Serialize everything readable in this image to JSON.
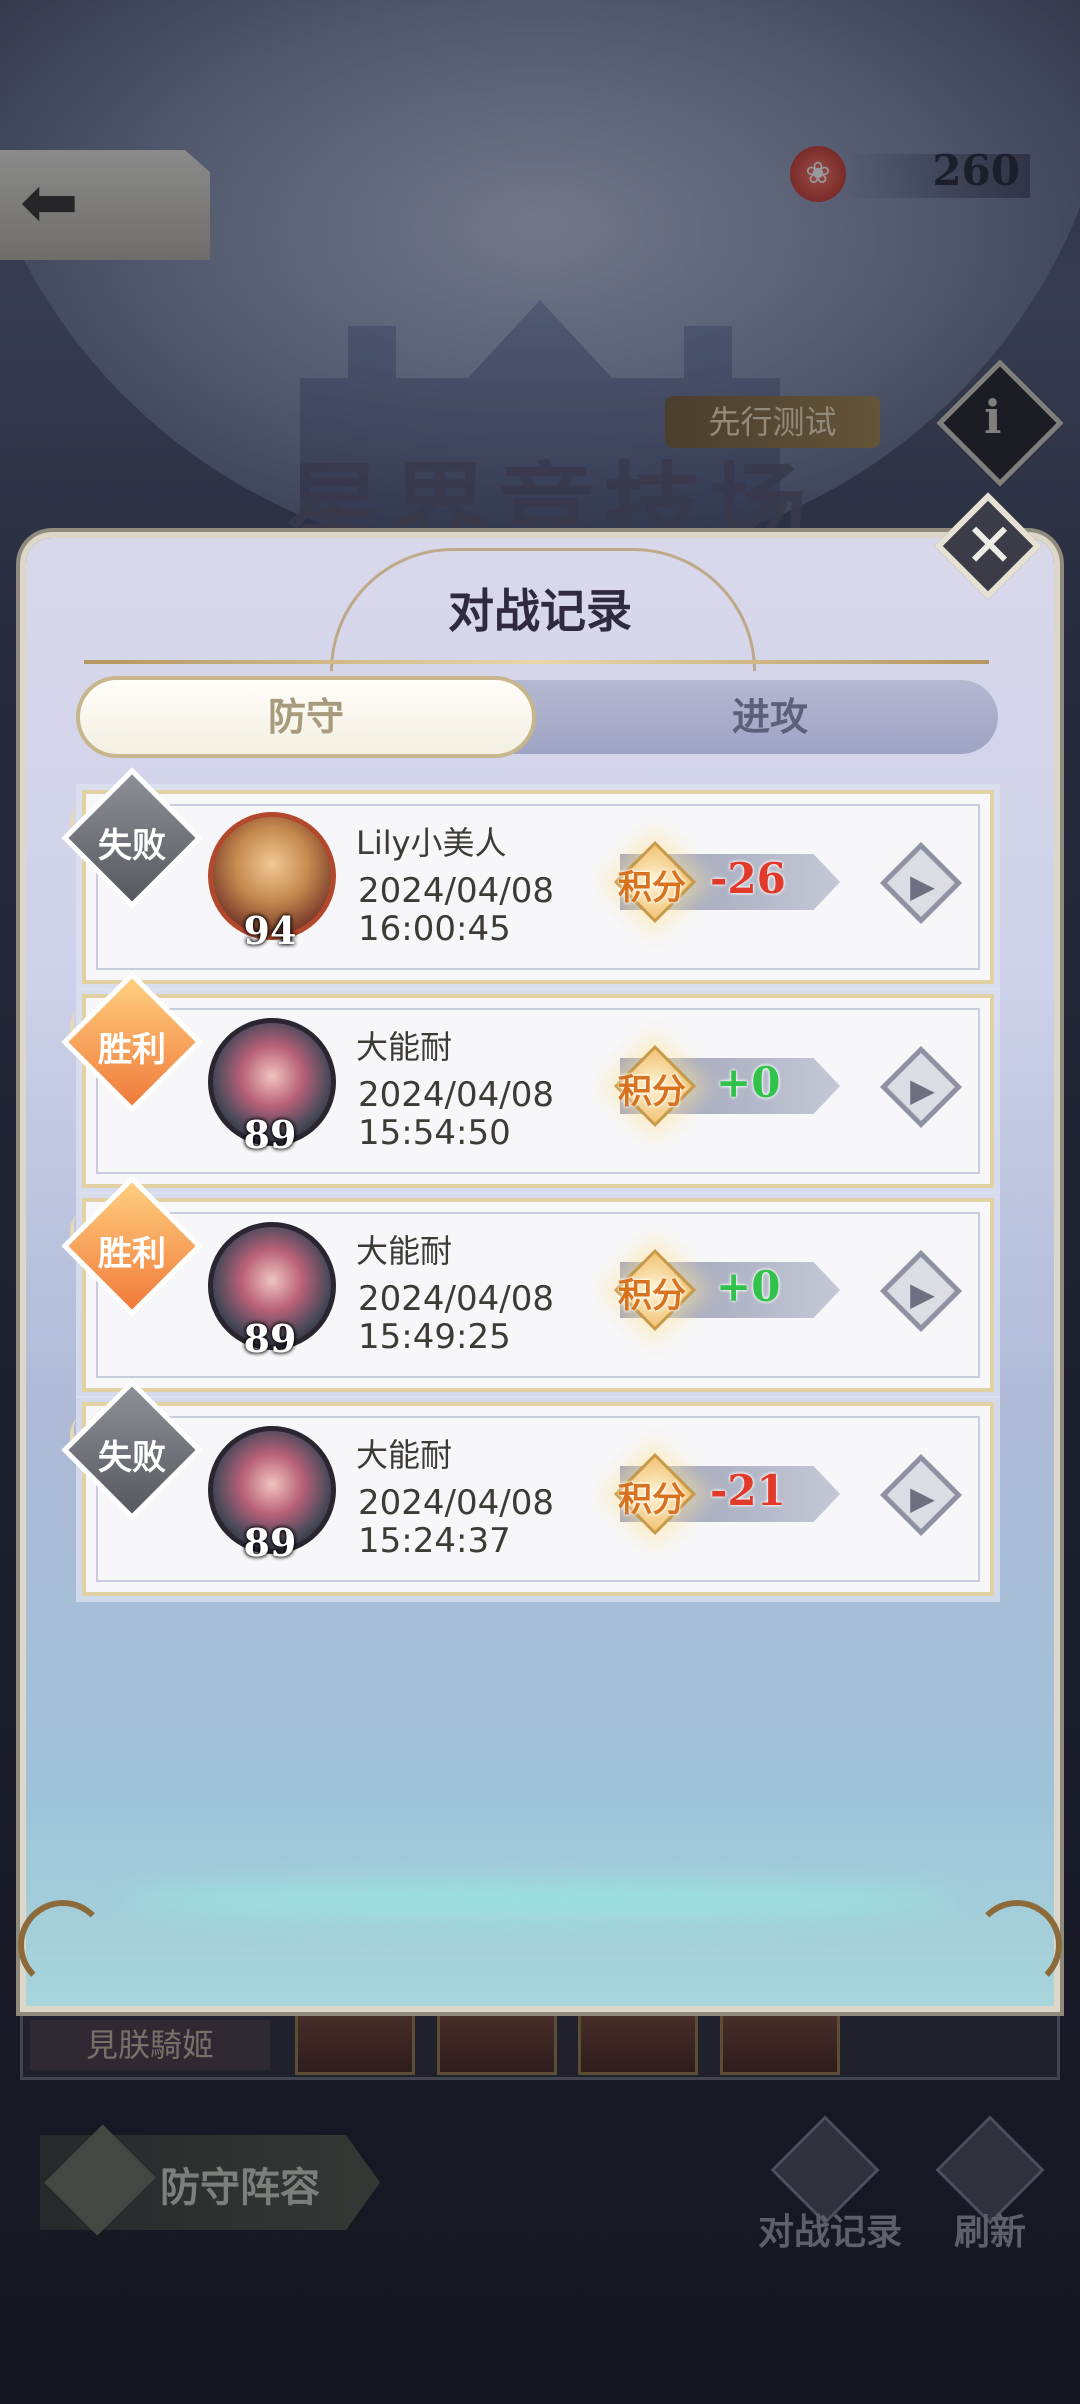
{
  "background": {
    "currency": {
      "value": "260"
    },
    "pre_test_label": "先行测试",
    "arena_title": "星界竞技场",
    "knight_tag": "見朕騎姬",
    "lineup_button_label": "防守阵容",
    "battle_record_button_label": "对战记录",
    "refresh_button_label": "刷新"
  },
  "modal": {
    "title": "对战记录",
    "tabs": [
      {
        "label": "防守",
        "active": true
      },
      {
        "label": "进攻",
        "active": false
      }
    ],
    "score_label": "积分",
    "records": [
      {
        "result": "失败",
        "outcome": "lose",
        "level": "94",
        "name": "Lily小美人",
        "date": "2024/04/08",
        "time": "16:00:45",
        "score": "-26",
        "score_sign": "neg"
      },
      {
        "result": "胜利",
        "outcome": "win",
        "level": "89",
        "name": "大能耐",
        "date": "2024/04/08",
        "time": "15:54:50",
        "score": "+0",
        "score_sign": "pos"
      },
      {
        "result": "胜利",
        "outcome": "win",
        "level": "89",
        "name": "大能耐",
        "date": "2024/04/08",
        "time": "15:49:25",
        "score": "+0",
        "score_sign": "pos"
      },
      {
        "result": "失败",
        "outcome": "lose",
        "level": "89",
        "name": "大能耐",
        "date": "2024/04/08",
        "time": "15:24:37",
        "score": "-21",
        "score_sign": "neg"
      }
    ]
  },
  "colors": {
    "accent_gold": "#c7b58c",
    "loss_red": "#e23a2a",
    "gain_green": "#31c24b",
    "win_orange": "#f07a3a"
  }
}
